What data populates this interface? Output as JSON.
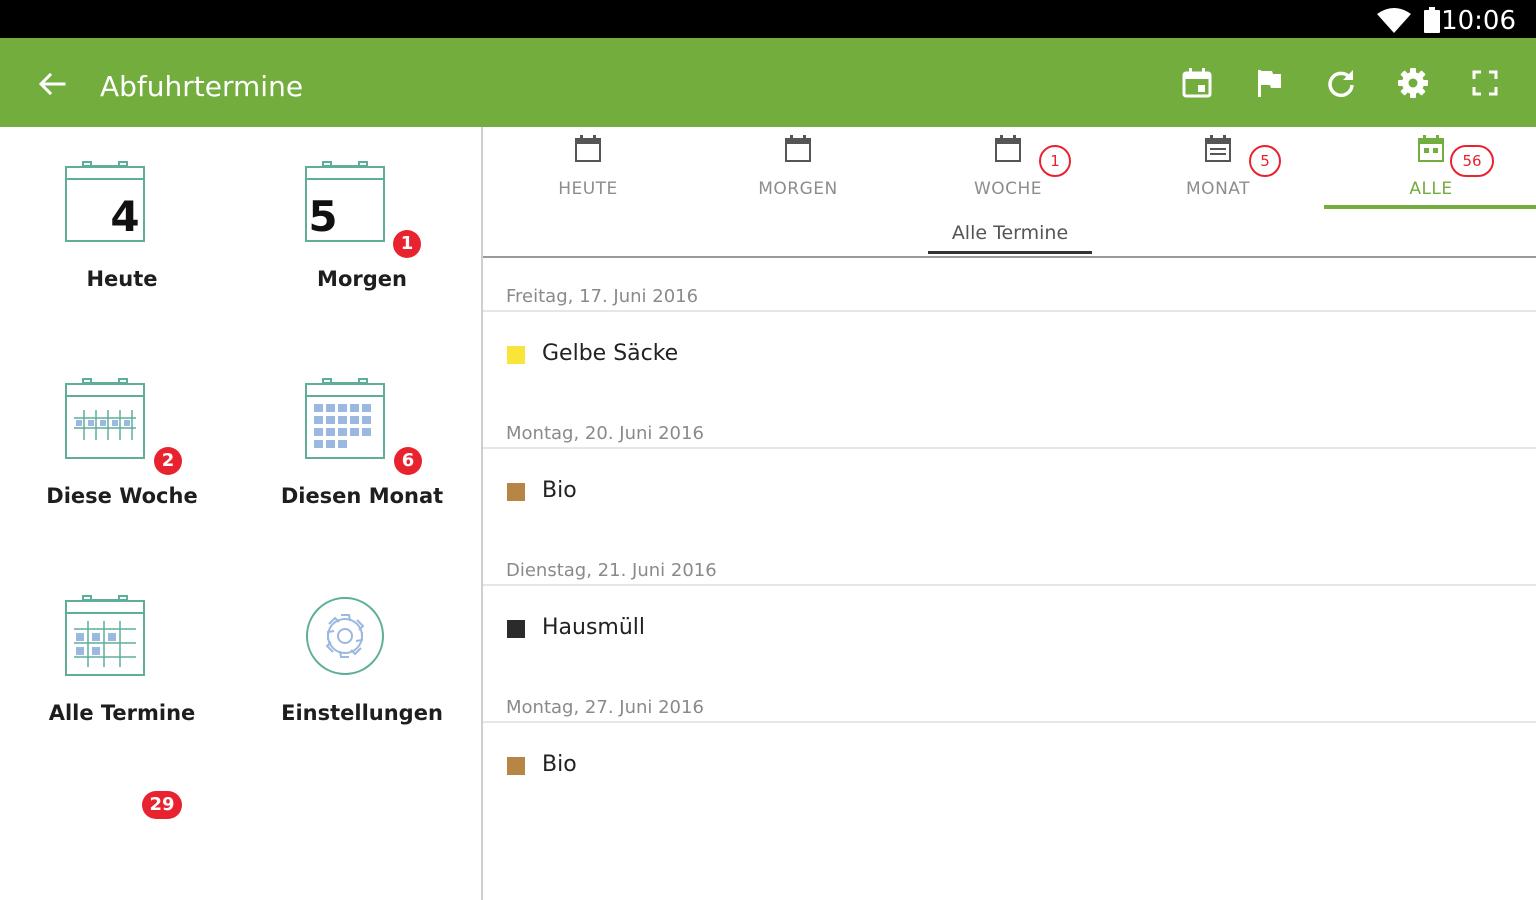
{
  "status_bar": {
    "time": "10:06"
  },
  "app_bar": {
    "title": "Abfuhrtermine",
    "actions": [
      "calendar-event-icon",
      "flag-icon",
      "refresh-icon",
      "settings-icon",
      "fullscreen-icon"
    ]
  },
  "tiles": [
    {
      "id": "heute",
      "label": "Heute",
      "number": "4",
      "badge": ""
    },
    {
      "id": "morgen",
      "label": "Morgen",
      "number": "5",
      "badge": "1"
    },
    {
      "id": "woche",
      "label": "Diese Woche",
      "badge": "2"
    },
    {
      "id": "monat",
      "label": "Diesen Monat",
      "badge": "6"
    },
    {
      "id": "alle",
      "label": "Alle Termine",
      "badge": "29"
    },
    {
      "id": "einstellungen",
      "label": "Einstellungen",
      "badge": ""
    }
  ],
  "tabs": [
    {
      "label": "HEUTE",
      "badge": ""
    },
    {
      "label": "MORGEN",
      "badge": ""
    },
    {
      "label": "WOCHE",
      "badge": "1"
    },
    {
      "label": "MONAT",
      "badge": "5"
    },
    {
      "label": "ALLE",
      "badge": "56"
    }
  ],
  "subtitle": "Alle Termine",
  "groups": [
    {
      "date": "Freitag, 17. Juni 2016",
      "item": "Gelbe Säcke",
      "color": "#f9e43a"
    },
    {
      "date": "Montag, 20. Juni 2016",
      "item": "Bio",
      "color": "#b78644"
    },
    {
      "date": "Dienstag, 21. Juni 2016",
      "item": "Hausmüll",
      "color": "#2b2b2b"
    },
    {
      "date": "Montag, 27. Juni 2016",
      "item": "Bio",
      "color": "#b78644"
    }
  ],
  "colors": {
    "accent": "#72ad3d",
    "badge": "#e8232f",
    "icon_teal": "#5fae9a"
  }
}
